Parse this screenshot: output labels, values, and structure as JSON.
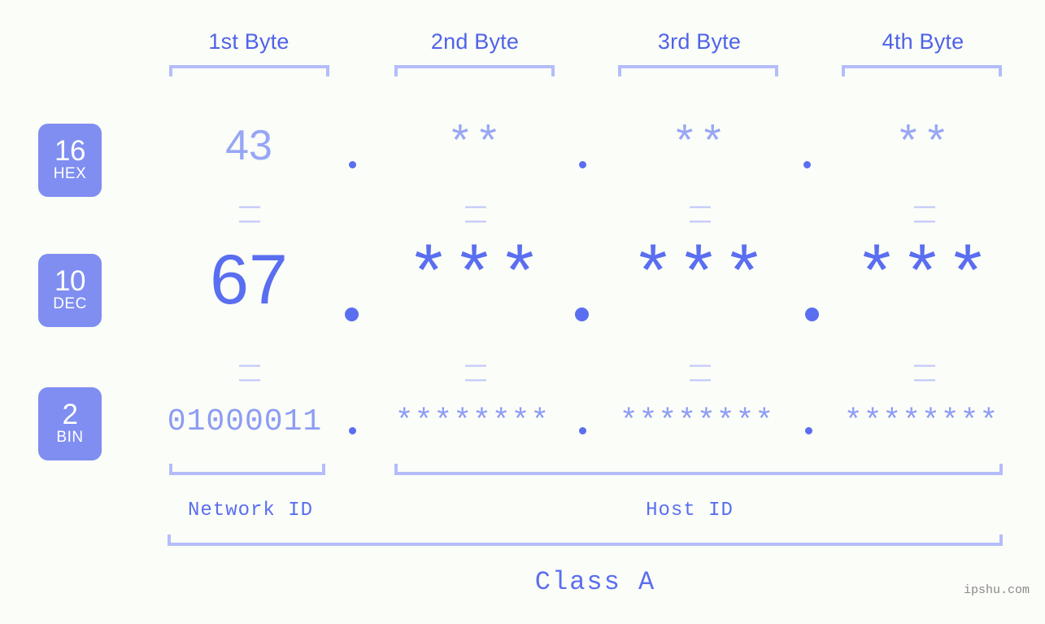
{
  "page": {
    "background_color": "#fbfdf8",
    "accent_color": "#5a6ef0",
    "accent_light_color": "#b4bdfb",
    "badge_color": "#7f8ef0"
  },
  "headers": [
    {
      "label": "1st Byte"
    },
    {
      "label": "2nd Byte"
    },
    {
      "label": "3rd Byte"
    },
    {
      "label": "4th Byte"
    }
  ],
  "radix_badges": [
    {
      "number": "16",
      "caption": "HEX"
    },
    {
      "number": "10",
      "caption": "DEC"
    },
    {
      "number": "2",
      "caption": "BIN"
    }
  ],
  "rows": {
    "hex": {
      "values": [
        "43",
        "**",
        "**",
        "**"
      ],
      "separators": [
        ".",
        ".",
        "."
      ]
    },
    "dec": {
      "values": [
        "67",
        "***",
        "***",
        "***"
      ],
      "separators": [
        ".",
        ".",
        "."
      ]
    },
    "bin": {
      "values": [
        "01000011",
        "********",
        "********",
        "********"
      ],
      "separators": [
        ".",
        ".",
        "."
      ]
    }
  },
  "equals_separators": {
    "symbol": "||",
    "hex_to_dec": [
      "||",
      "||",
      "||",
      "||"
    ],
    "dec_to_bin": [
      "||",
      "||",
      "||",
      "||"
    ]
  },
  "footer": {
    "network_id_label": "Network ID",
    "host_id_label": "Host ID",
    "class_label": "Class A"
  },
  "watermark": {
    "text": "ipshu.com"
  }
}
